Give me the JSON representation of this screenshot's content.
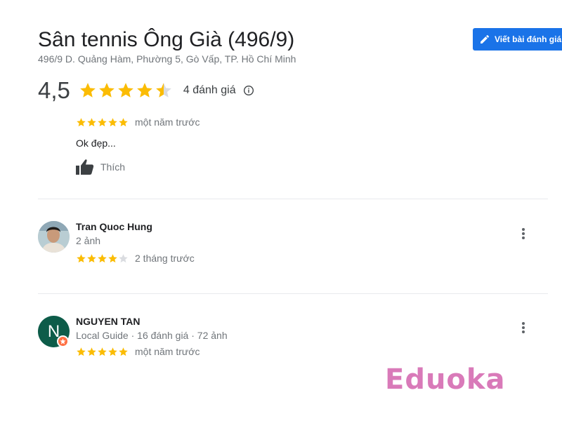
{
  "place": {
    "title": "Sân tennis Ông Già (496/9)",
    "address": "496/9 D. Quảng Hàm, Phường 5, Gò Vấp, TP. Hồ Chí Minh"
  },
  "actions": {
    "write_review_label": "Viết bài đánh giá",
    "write_review_icon": "pencil-icon"
  },
  "summary": {
    "rating": "4,5",
    "rating_value": 4.5,
    "review_count_label": "4 đánh giá",
    "info_icon": "info-icon"
  },
  "colors": {
    "star_filled": "#fbbc04",
    "star_empty": "#dadce0",
    "button_blue": "#1a73e8",
    "avatar_green": "#0d5c49",
    "local_guide_badge": "#ff7043",
    "watermark": "#d97ab9"
  },
  "reviews": [
    {
      "stars": 5,
      "time": "một năm trước",
      "text": "Ok đẹp...",
      "like_label": "Thích",
      "like_icon": "thumbs-up-icon"
    },
    {
      "name": "Tran Quoc Hung",
      "meta": "2 ảnh",
      "stars": 4,
      "time": "2 tháng trước",
      "more_icon": "more-vert-icon"
    },
    {
      "name": "NGUYEN TAN",
      "avatar_letter": "N",
      "meta": "Local Guide · 16 đánh giá · 72 ảnh",
      "stars": 5,
      "time": "một năm trước",
      "more_icon": "more-vert-icon"
    }
  ],
  "watermark": "Eduoka"
}
